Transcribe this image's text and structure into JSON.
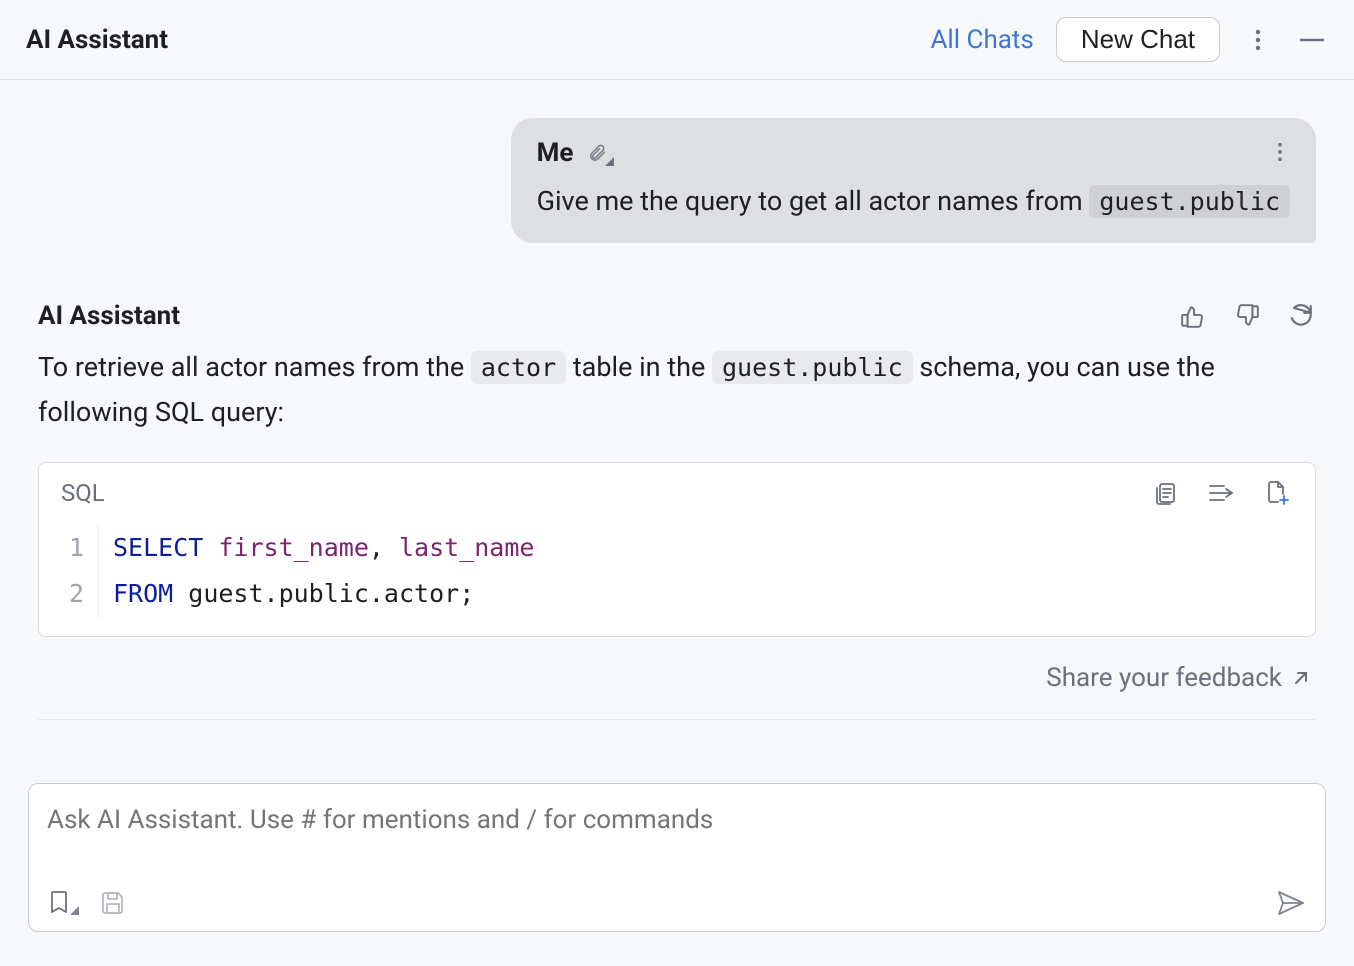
{
  "header": {
    "title": "AI Assistant",
    "all_chats_label": "All Chats",
    "new_chat_label": "New Chat"
  },
  "user_message": {
    "sender": "Me",
    "text_prefix": "Give me the query to get all actor names from ",
    "code": "guest.public"
  },
  "assistant_message": {
    "sender": "AI Assistant",
    "text_parts": {
      "p1": "To retrieve all actor names from the ",
      "code1": "actor",
      "p2": " table in the ",
      "code2": "guest.public",
      "p3": " schema, you can use the following SQL query:"
    }
  },
  "code_block": {
    "language": "SQL",
    "lines": [
      {
        "n": "1",
        "kw": "SELECT",
        "rest_a": " ",
        "id1": "first_name",
        "mid": ", ",
        "id2": "last_name"
      },
      {
        "n": "2",
        "kw": "FROM",
        "rest": " guest.public.actor;"
      }
    ]
  },
  "feedback": {
    "label": "Share your feedback"
  },
  "input": {
    "placeholder": "Ask AI Assistant. Use # for mentions and / for commands"
  }
}
